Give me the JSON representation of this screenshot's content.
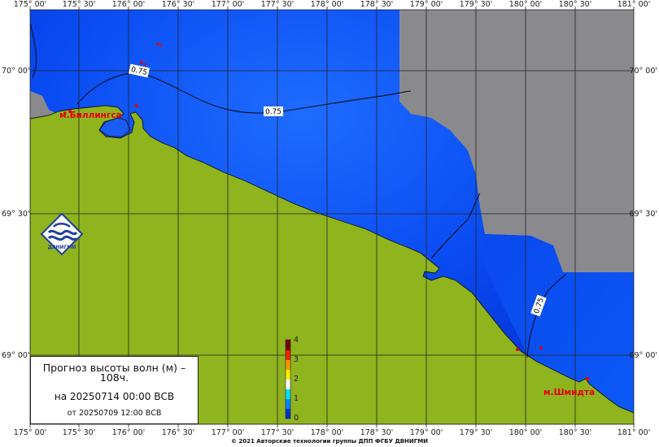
{
  "map": {
    "lon_ticks": [
      "175° 00'",
      "175° 30'",
      "176° 00'",
      "176° 30'",
      "177° 00'",
      "177° 30'",
      "178° 00'",
      "178° 30'",
      "179° 00'",
      "179° 30'",
      "180° 00'",
      "180° 30'",
      "181° 00'"
    ],
    "lat_ticks": [
      "70° 00'",
      "69° 30'",
      "69° 00'"
    ],
    "isoline_labels": [
      "0.75",
      "0.75",
      "0.75"
    ],
    "places": {
      "west": "м.Биллингса",
      "east": "м.Шмидта"
    }
  },
  "colorbar": {
    "ticks": [
      "4",
      "3",
      "2",
      "1",
      "0"
    ],
    "colors": [
      "#0033cc",
      "#0088ff",
      "#00e5ff",
      "#ffffff",
      "#ffee00",
      "#ff9900",
      "#ee2200",
      "#990000"
    ]
  },
  "legend": {
    "title": "Прогноз высоты волн (м) – 108ч.",
    "valid": "на 20250714 00:00 ВСВ",
    "issued": "от 20250709 12:00 ВСВ"
  },
  "logo": {
    "text": "ДВНИГМИ"
  },
  "footer": {
    "copyright": "© 2021 Авторские технологии группы ДПП ФГБУ ДВНИГМИ"
  },
  "colors": {
    "sea_deep": "#0033dd",
    "sea_light": "#1a66ff",
    "land": "#8fb41e",
    "no_data": "#8a8a8e",
    "grid": "#222222"
  }
}
